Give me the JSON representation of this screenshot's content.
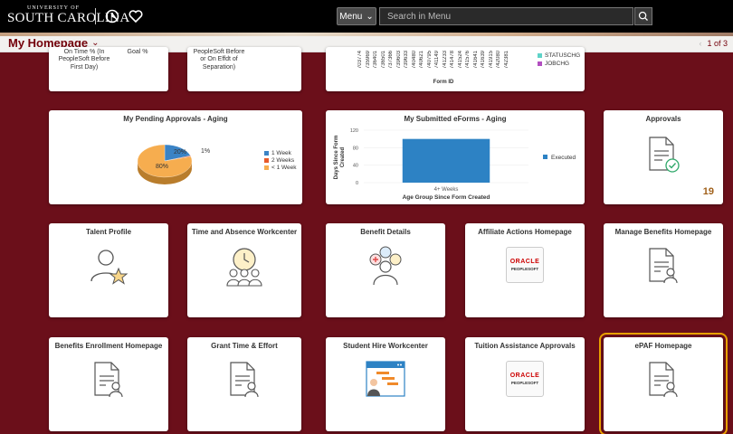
{
  "topbar": {
    "logo_small": "UNIVERSITY OF",
    "logo_big": "SOUTH CAROLINA",
    "menu_label": "Menu",
    "search_placeholder": "Search in Menu"
  },
  "homepage": {
    "title": "My Homepage",
    "pager": "1 of 3"
  },
  "partial_tiles": [
    {
      "line1": "On Time % (In",
      "line2": "PeopleSoft Before",
      "line3": "First Day)",
      "extra": "Goal %"
    },
    {
      "line1": "PeopleSoft Before",
      "line2": "or On Effdt of",
      "line3": "Separation)"
    }
  ],
  "form_chart": {
    "xlabel": "Form ID",
    "ids": [
      "703774",
      "735969",
      "736401",
      "736501",
      "737366",
      "739603",
      "739633",
      "740480",
      "740621",
      "740795",
      "741149",
      "741233",
      "741478",
      "741524",
      "741576",
      "741641",
      "741639",
      "741915",
      "742080",
      "742381"
    ],
    "legend": [
      {
        "name": "STATUSCHG",
        "color": "#5fd3c8"
      },
      {
        "name": "JOBCHG",
        "color": "#b24fc0"
      }
    ]
  },
  "pending_approvals": {
    "title": "My Pending Approvals - Aging",
    "chart_data": {
      "type": "pie",
      "categories": [
        "1 Week",
        "2 Weeks",
        "< 1 Week"
      ],
      "values": [
        20,
        1,
        80
      ],
      "colors": [
        "#3b83c5",
        "#e85a2a",
        "#f6ad4f"
      ],
      "data_labels": [
        "20%",
        "1%",
        "80%"
      ],
      "legend": "right"
    }
  },
  "submitted_eforms": {
    "title": "My Submitted eForms - Aging",
    "chart_data": {
      "type": "bar",
      "categories": [
        "4+ Weeks"
      ],
      "series": [
        {
          "name": "Executed",
          "values": [
            100
          ],
          "color": "#2d82c4"
        }
      ],
      "ylabel": "Days Since Form Created",
      "xlabel": "Age Group Since Form Created",
      "ylim": [
        0,
        120
      ],
      "yticks": [
        0,
        40,
        80,
        120
      ]
    }
  },
  "approvals": {
    "title": "Approvals",
    "count": "19"
  },
  "tiles_row2": [
    {
      "title": "Talent Profile",
      "icon": "person-star-icon"
    },
    {
      "title": "Time and Absence Workcenter",
      "icon": "clock-group-icon"
    },
    {
      "title": "Benefit Details",
      "icon": "benefits-person-icon"
    },
    {
      "title": "Affiliate Actions Homepage",
      "icon": "oracle-peoplesoft-logo"
    },
    {
      "title": "Manage Benefits Homepage",
      "icon": "document-person-icon"
    }
  ],
  "tiles_row3": [
    {
      "title": "Benefits Enrollment Homepage",
      "icon": "document-person-icon"
    },
    {
      "title": "Grant Time & Effort",
      "icon": "document-person-icon"
    },
    {
      "title": "Student Hire Workcenter",
      "icon": "workcenter-icon"
    },
    {
      "title": "Tuition Assistance Approvals",
      "icon": "oracle-peoplesoft-logo"
    },
    {
      "title": "ePAF Homepage",
      "icon": "document-person-icon"
    }
  ],
  "oracle": {
    "line1": "ORACLE",
    "line2": "PEOPLESOFT"
  }
}
